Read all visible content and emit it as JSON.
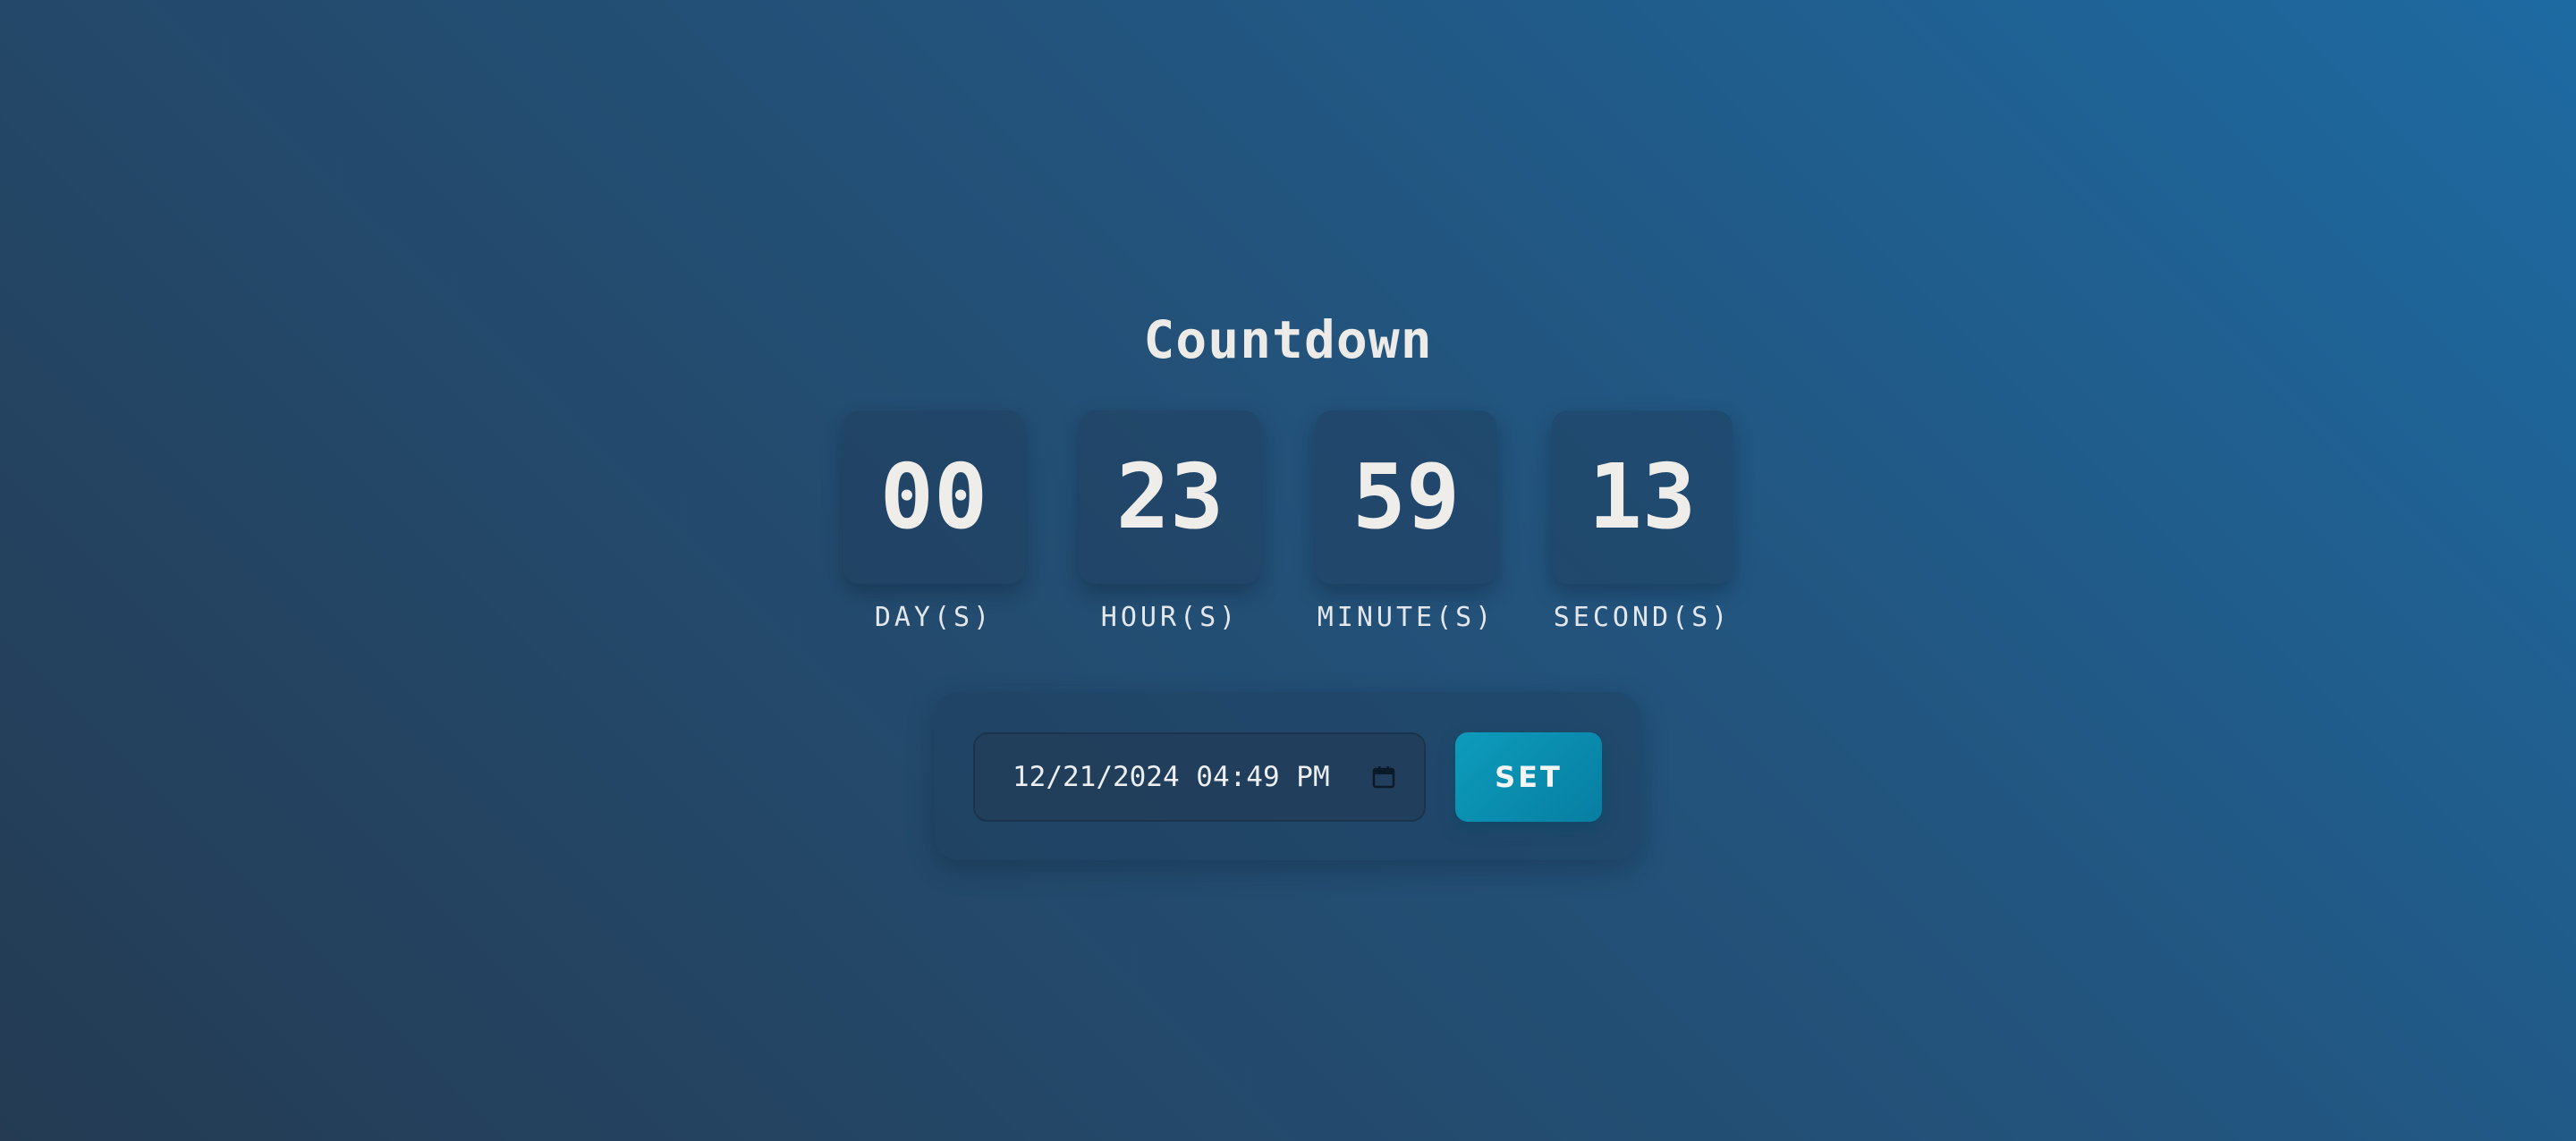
{
  "title": "Countdown",
  "units": [
    {
      "value": "00",
      "label": "DAY(S)"
    },
    {
      "value": "23",
      "label": "HOUR(S)"
    },
    {
      "value": "59",
      "label": "MINUTE(S)"
    },
    {
      "value": "13",
      "label": "SECOND(S)"
    }
  ],
  "form": {
    "datetime_value": "12/21/2024 04:49 PM",
    "set_label": "SET",
    "calendar_icon": "calendar-icon"
  },
  "colors": {
    "background_start": "#1d6aa2",
    "background_end": "#243b53",
    "button": "#0d9cbc",
    "text": "#ecebe8"
  }
}
